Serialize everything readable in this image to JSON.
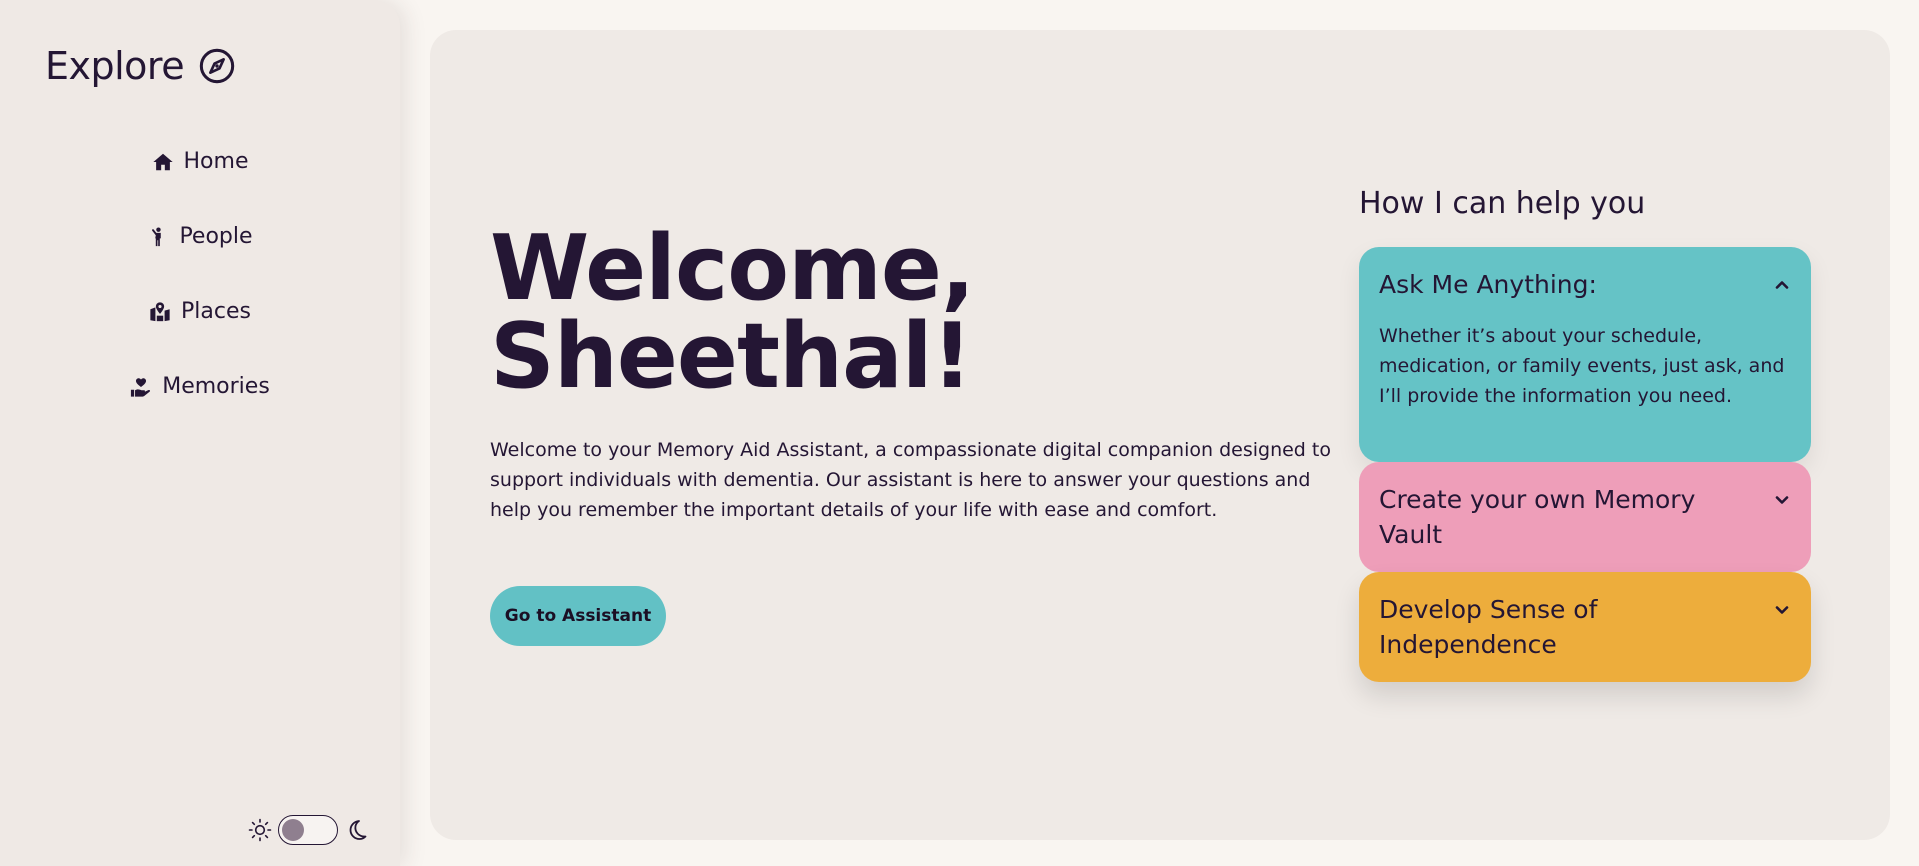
{
  "sidebar": {
    "brand": "Explore",
    "brand_icon": "compass-icon",
    "items": [
      {
        "label": "Home",
        "icon": "home-icon"
      },
      {
        "label": "People",
        "icon": "person-waving-icon"
      },
      {
        "label": "Places",
        "icon": "map-location-icon"
      },
      {
        "label": "Memories",
        "icon": "hand-holding-heart-icon"
      }
    ],
    "theme_toggle": {
      "light_icon": "sun-icon",
      "dark_icon": "moon-icon",
      "state": "light"
    }
  },
  "main": {
    "headline_line1": "Welcome,",
    "headline_line2": "Sheethal!",
    "intro": "Welcome to your Memory Aid Assistant, a compassionate digital companion designed to support individuals with dementia. Our assistant is here to answer your questions and help you remember the important details of your life with ease and comfort.",
    "cta_label": "Go to Assistant",
    "help_title": "How I can help you",
    "accordion": [
      {
        "title": "Ask Me Anything:",
        "expanded": true,
        "body": "Whether it’s about your schedule, medication, or family events, just ask, and I’ll provide the information you need.",
        "color": "#65c3c6"
      },
      {
        "title": "Create your own Memory Vault",
        "expanded": false,
        "color": "#ee9eb9"
      },
      {
        "title": "Develop Sense of Independence",
        "expanded": false,
        "color": "#edad3c"
      }
    ]
  },
  "colors": {
    "accent": "#62c1c5",
    "text": "#241634",
    "background": "#f9f5f1",
    "panel": "#efeae6"
  }
}
